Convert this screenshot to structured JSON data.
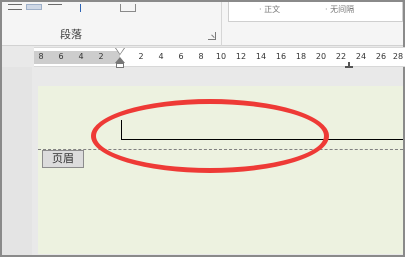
{
  "ribbon": {
    "paragraph_group_label": "段落",
    "right_pane_texts": [
      "· 正文",
      "· 无间隔"
    ]
  },
  "ruler": {
    "left_ticks": [
      "8",
      "6",
      "4",
      "2"
    ],
    "right_ticks": [
      "2",
      "4",
      "6",
      "8",
      "10",
      "12",
      "14",
      "16",
      "18",
      "20",
      "22",
      "24",
      "26",
      "28"
    ]
  },
  "document": {
    "header_tag": "页眉"
  },
  "colors": {
    "page_background": "#edf2e0",
    "annotation": "#ee3a36",
    "ruler_margin": "#cdcdcd"
  },
  "icons": [
    "line-spacing-icon",
    "align-icon",
    "sort-icon",
    "border-icon",
    "dialog-launcher-icon",
    "indent-marker-icon",
    "tab-stop-icon"
  ]
}
